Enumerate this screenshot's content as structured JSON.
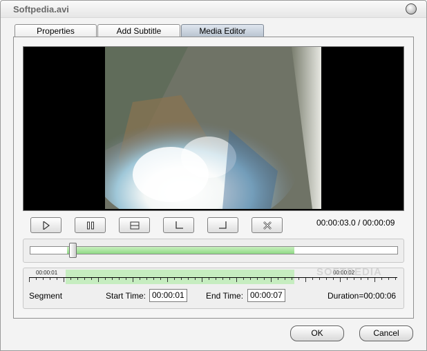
{
  "window": {
    "title": "Softpedia.avi"
  },
  "tabs": [
    {
      "label": "Properties"
    },
    {
      "label": "Add Subtitle"
    },
    {
      "label": "Media Editor"
    }
  ],
  "playback": {
    "timecode": "00:00:03.0 / 00:00:09"
  },
  "controls": [
    "play-icon",
    "pause-icon",
    "stop-icon",
    "mark-in-icon",
    "mark-out-icon",
    "delete-icon"
  ],
  "timeline": {
    "selection_start_fraction": 0.1,
    "selection_end_fraction": 0.72,
    "playhead_fraction": 0.115
  },
  "ruler": {
    "label_start": "00:00:01",
    "label_end": "00:00:02",
    "selection_start_fraction": 0.1,
    "selection_end_fraction": 0.72
  },
  "watermark": "SOFTPEDIA",
  "segment": {
    "label": "Segment",
    "start_label": "Start Time:",
    "start_value": "00:00:01",
    "end_label": "End Time:",
    "end_value": "00:00:07",
    "duration": "Duration=00:00:06"
  },
  "buttons": {
    "ok": "OK",
    "cancel": "Cancel"
  }
}
